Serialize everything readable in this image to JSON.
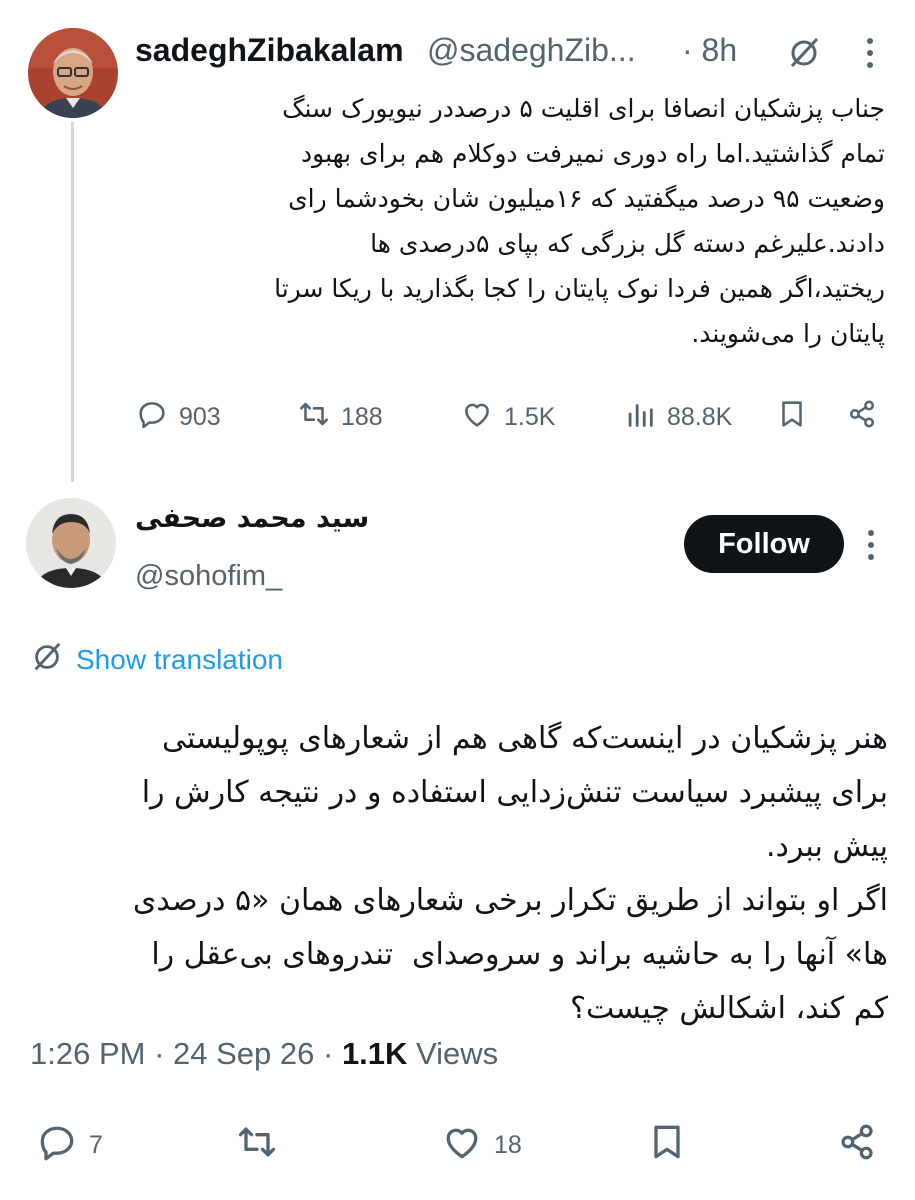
{
  "tweet1": {
    "display_name": "sadeghZibakalam",
    "handle": "@sadeghZib...",
    "time": "· 8h",
    "text": "جناب پزشکیان انصافا برای اقلیت ۵ درصددر نیویورک سنگ\nتمام گذاشتید.اما راه دوری نمیرفت دوکلام هم برای بهبود\nوضعیت ۹۵ درصد میگفتید که ۱۶میلیون شان بخودشما رای\nدادند.علیرغم دسته گل بزرگی که بپای ۵درصدی ها\nریختید،اگر همین فردا نوک پایتان را کجا بگذارید با ریکا سرتا\nپایتان را می‌شویند.",
    "replies": "903",
    "reposts": "188",
    "likes": "1.5K",
    "views": "88.8K"
  },
  "tweet2": {
    "display_name": "سید محمد صحفی",
    "handle": "@sohofim_",
    "follow_label": "Follow",
    "show_translation": "Show translation",
    "text": "هنر پزشکیان در اینست‌که گاهی هم از شعارهای پوپولیستی\nبرای پیشبرد سیاست تنش‌زدایی استفاده و در نتیجه کارش را\nپیش ببرد.\nاگر او بتواند از طریق تکرار برخی شعارهای همان «۵ درصدی\nها» آنها را به حاشیه براند و سروصدای  تندروهای بی‌عقل را\nکم کند، اشکالش چیست؟",
    "time": "1:26 PM",
    "date": "24 Sep 26",
    "views_count": "1.1K",
    "views_label": "Views",
    "replies": "7",
    "likes": "18"
  },
  "colors": {
    "text": "#0f1419",
    "secondary": "#536471",
    "link": "#1d9bf0",
    "thread_line": "#cfd9de"
  },
  "icons": [
    "grok-slash-icon",
    "more-icon",
    "reply-icon",
    "repost-icon",
    "like-icon",
    "views-icon",
    "bookmark-icon",
    "share-icon",
    "translate-icon"
  ]
}
